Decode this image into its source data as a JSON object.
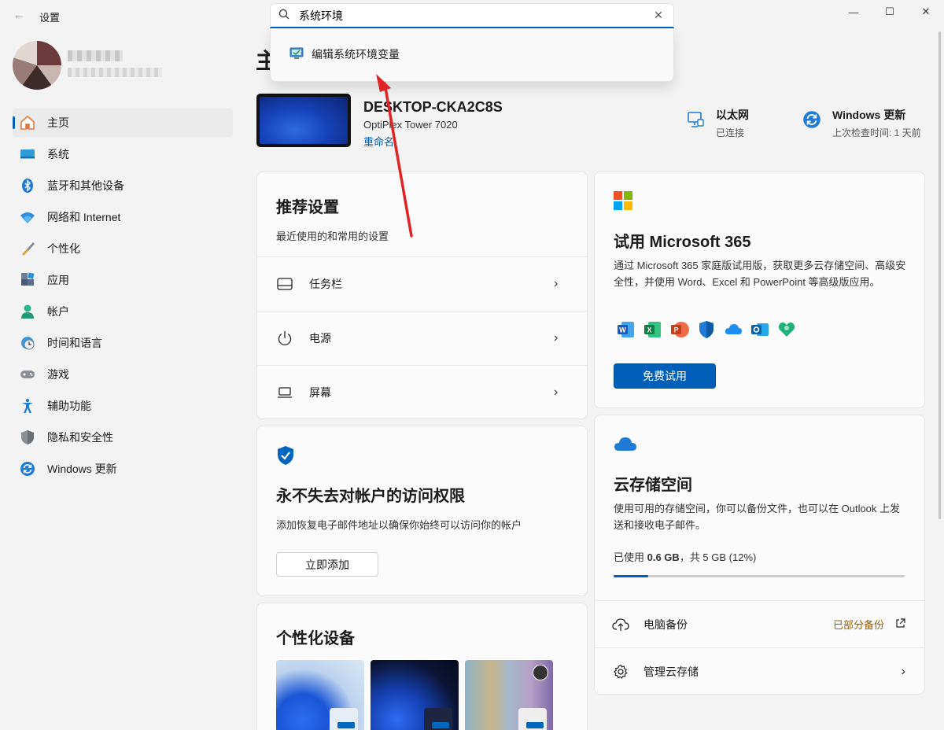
{
  "window": {
    "title": "设置",
    "back_icon": "back-arrow-icon",
    "controls": {
      "minimize": "—",
      "maximize": "☐",
      "close": "✕"
    }
  },
  "profile": {},
  "sidebar": {
    "items": [
      {
        "label": "主页",
        "icon": "home-icon",
        "active": true
      },
      {
        "label": "系统",
        "icon": "system-icon"
      },
      {
        "label": "蓝牙和其他设备",
        "icon": "bluetooth-icon"
      },
      {
        "label": "网络和 Internet",
        "icon": "wifi-icon"
      },
      {
        "label": "个性化",
        "icon": "brush-icon"
      },
      {
        "label": "应用",
        "icon": "apps-icon"
      },
      {
        "label": "帐户",
        "icon": "account-icon"
      },
      {
        "label": "时间和语言",
        "icon": "clock-globe-icon"
      },
      {
        "label": "游戏",
        "icon": "gamepad-icon"
      },
      {
        "label": "辅助功能",
        "icon": "accessibility-icon"
      },
      {
        "label": "隐私和安全性",
        "icon": "shield-icon"
      },
      {
        "label": "Windows 更新",
        "icon": "update-icon"
      }
    ]
  },
  "search": {
    "value": "系统环境",
    "suggestion": "编辑系统环境变量"
  },
  "page": {
    "title": "主"
  },
  "device": {
    "name": "DESKTOP-CKA2C8S",
    "model": "OptiPlex Tower 7020",
    "rename": "重命名"
  },
  "status": {
    "ethernet": {
      "title": "以太网",
      "detail": "已连接"
    },
    "update": {
      "title": "Windows 更新",
      "detail": "上次检查时间: 1 天前"
    }
  },
  "recommended": {
    "title": "推荐设置",
    "subtitle": "最近使用的和常用的设置",
    "rows": [
      {
        "label": "任务栏",
        "icon": "taskbar-icon"
      },
      {
        "label": "电源",
        "icon": "power-icon"
      },
      {
        "label": "屏幕",
        "icon": "laptop-icon"
      }
    ]
  },
  "account_card": {
    "title": "永不失去对帐户的访问权限",
    "subtitle": "添加恢复电子邮件地址以确保你始终可以访问你的帐户",
    "button": "立即添加"
  },
  "personalize": {
    "title": "个性化设备"
  },
  "m365": {
    "title": "试用 Microsoft 365",
    "body": "通过 Microsoft 365 家庭版试用版，获取更多云存储空间、高级安全性，并使用 Word、Excel 和 PowerPoint 等高级版应用。",
    "button": "免费试用"
  },
  "cloud": {
    "title": "云存储空间",
    "body": "使用可用的存储空间，你可以备份文件，也可以在 Outlook 上发送和接收电子邮件。",
    "usage_prefix": "已使用 ",
    "usage_value": "0.6 GB",
    "usage_suffix": "，共 5 GB (12%)",
    "usage_fraction": 0.12,
    "backup_label": "电脑备份",
    "backup_status": "已部分备份",
    "manage_label": "管理云存储"
  },
  "colors": {
    "accent": "#005fb8",
    "warning": "#9d5d00"
  }
}
